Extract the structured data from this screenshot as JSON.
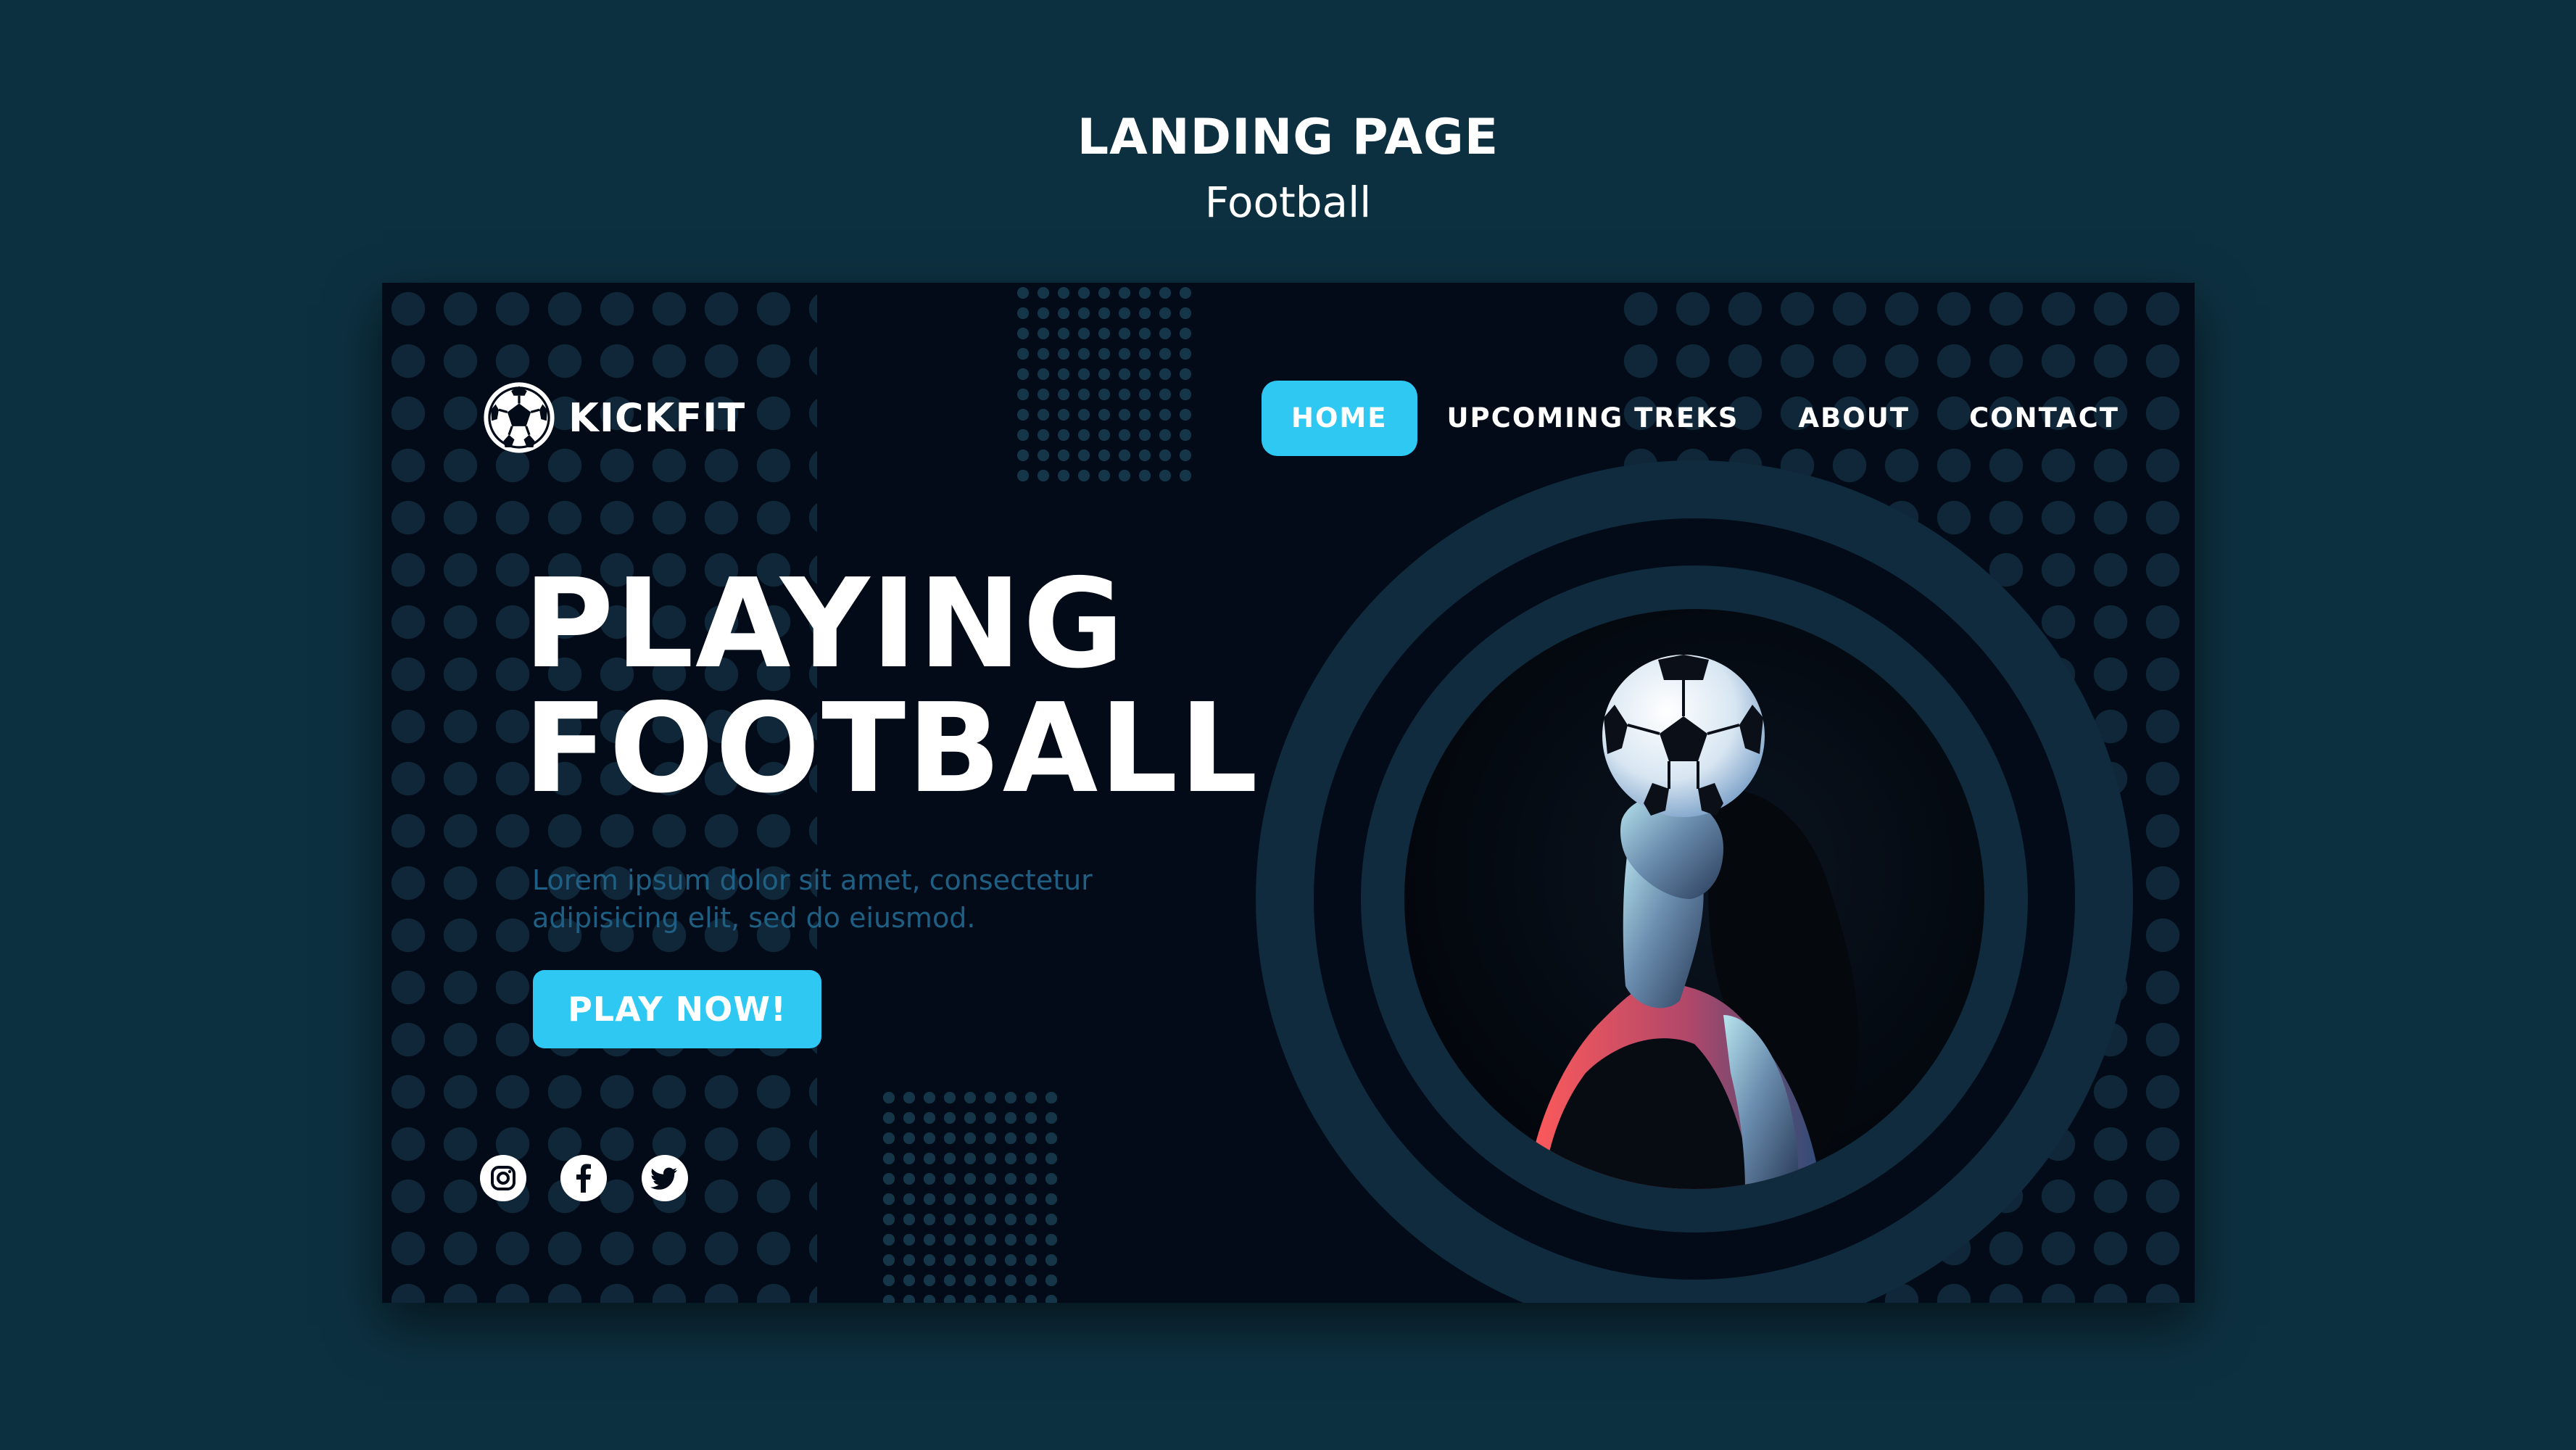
{
  "showcase": {
    "title": "LANDING PAGE",
    "subtitle": "Football"
  },
  "brand": {
    "name": "KICKFIT",
    "icon": "soccer-ball-icon"
  },
  "nav": {
    "items": [
      {
        "label": "HOME",
        "active": true
      },
      {
        "label": "UPCOMING TREKS",
        "active": false
      },
      {
        "label": "ABOUT",
        "active": false
      },
      {
        "label": "CONTACT",
        "active": false
      }
    ]
  },
  "hero": {
    "title_line1": "PLAYING",
    "title_line2": "FOOTBALL",
    "text": "Lorem ipsum dolor sit amet, consectetur adipisicing elit, sed do eiusmod.",
    "cta_label": "PLAY NOW!"
  },
  "social": {
    "icons": [
      "instagram-icon",
      "facebook-icon",
      "twitter-icon"
    ]
  },
  "colors": {
    "page_background": "#0d3040",
    "panel_background": "#020b17",
    "accent": "#2ec8f2",
    "ring": "#0f2b3d",
    "muted_text": "#1f5f83"
  }
}
